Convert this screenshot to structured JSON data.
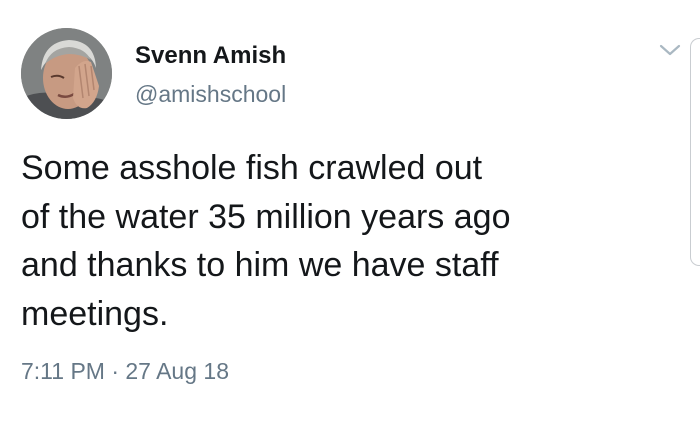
{
  "author": {
    "display_name": "Svenn Amish",
    "handle": "@amishschool",
    "avatar_icon": "facepalm-portrait-avatar"
  },
  "tweet": {
    "lines": [
      "Some asshole fish crawled out",
      "of the water 35 million years ago",
      "and thanks to him we have staff",
      "meetings."
    ],
    "timestamp": "7:11 PM · 27 Aug 18"
  },
  "icons": {
    "menu": "chevron-down-icon"
  },
  "colors": {
    "text_primary": "#14171a",
    "text_secondary": "#657786",
    "chevron": "#aab8c2",
    "edge": "#c9cdd1"
  }
}
